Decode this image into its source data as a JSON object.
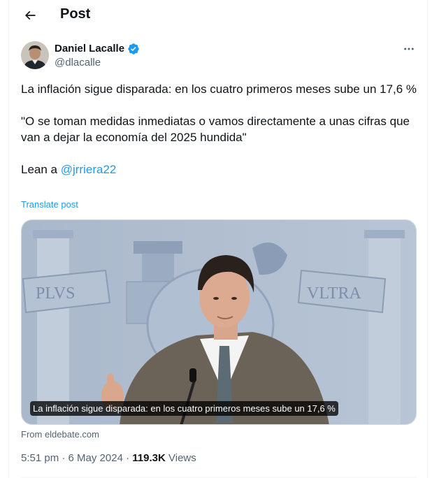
{
  "header": {
    "title": "Post",
    "back_icon": "arrow-left-icon"
  },
  "author": {
    "name": "Daniel Lacalle",
    "handle": "@dlacalle",
    "verified_color": "#1d9bf0"
  },
  "tweet": {
    "paragraph1": "La inflación sigue disparada: en los cuatro primeros meses sube un 17,6 %",
    "paragraph2": "\"O se toman medidas inmediatas o vamos directamente a unas cifras que van a dejar la economía del 2025 hundida\"",
    "paragraph3_prefix": "Lean a ",
    "mention": "@jrriera22",
    "translate_label": "Translate post"
  },
  "media": {
    "caption": "La inflación sigue disparada: en los cuatro primeros meses sube un 17,6 %",
    "source": "From eldebate.com",
    "banner_left": "PLVS",
    "banner_right": "VLTRA"
  },
  "meta": {
    "time": "5:51 pm",
    "separator": "·",
    "date": "6 May 2024",
    "separator2": "·",
    "views_count": "119.3K",
    "views_label": "Views"
  },
  "colors": {
    "accent": "#1d9bf0",
    "text_primary": "#0f1419",
    "text_secondary": "#536471"
  }
}
